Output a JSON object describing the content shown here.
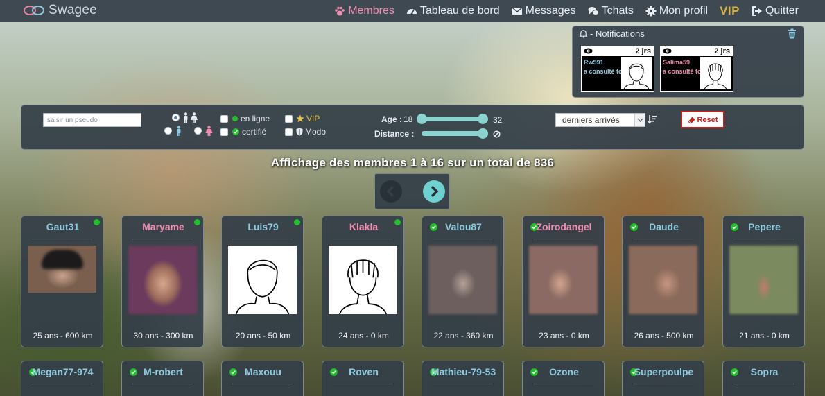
{
  "app": {
    "logo_text": "Swagee"
  },
  "nav": {
    "items": [
      {
        "label": "Membres",
        "icon": "paw-icon"
      },
      {
        "label": "Tableau de bord",
        "icon": "dashboard-icon"
      },
      {
        "label": "Messages",
        "icon": "envelope-icon"
      },
      {
        "label": "Tchats",
        "icon": "chat-bubbles-icon"
      },
      {
        "label": "Mon profil",
        "icon": "gear-icon"
      },
      {
        "label": "VIP",
        "icon": "vip-text"
      },
      {
        "label": "Quitter",
        "icon": "sign-out-icon"
      }
    ],
    "active_color": "#f08db0",
    "vip_color": "#d6b23e"
  },
  "notifications": {
    "title": "- Notifications",
    "items": [
      {
        "days": "2 jrs",
        "username": "Rw591",
        "message": "a consulté ton profil",
        "gender": "male"
      },
      {
        "days": "2 jrs",
        "username": "Salima59",
        "message": "a consulté ton profil",
        "gender": "female"
      }
    ]
  },
  "filters": {
    "pseudo_placeholder": "saisir un pseudo",
    "online_label": "en ligne",
    "certified_label": "certifié",
    "vip_label": "VIP",
    "modo_label": "Modo",
    "age_label": "Age :",
    "age_min": "18",
    "age_max": "32",
    "distance_label": "Distance :",
    "sort_selected": "derniers arrivés",
    "reset_label": "Reset"
  },
  "display_text": "Affichage des membres 1 à 16 sur un total de 836",
  "members_row1": [
    {
      "name": "Gaut31",
      "info": "25 ans - 600 km",
      "gender": "male",
      "online": true,
      "certified": false,
      "photo": "blurred"
    },
    {
      "name": "Maryame",
      "info": "30 ans - 300 km",
      "gender": "female",
      "online": true,
      "certified": false,
      "photo": "blurred"
    },
    {
      "name": "Luis79",
      "info": "20 ans - 50 km",
      "gender": "male",
      "online": true,
      "certified": false,
      "photo": "avatar-male"
    },
    {
      "name": "Klakla",
      "info": "24 ans - 0 km",
      "gender": "female",
      "online": true,
      "certified": false,
      "photo": "avatar-female"
    },
    {
      "name": "Valou87",
      "info": "22 ans - 360 km",
      "gender": "male",
      "online": false,
      "certified": true,
      "photo": "blurred"
    },
    {
      "name": "Zoirodangel",
      "info": "23 ans - 0 km",
      "gender": "female",
      "online": false,
      "certified": true,
      "photo": "blurred"
    },
    {
      "name": "Daude",
      "info": "26 ans - 500 km",
      "gender": "male",
      "online": false,
      "certified": true,
      "photo": "blurred"
    },
    {
      "name": "Pepere",
      "info": "21 ans - 0 km",
      "gender": "male",
      "online": false,
      "certified": true,
      "photo": "blurred"
    }
  ],
  "members_row2": [
    {
      "name": "Megan77-974",
      "gender": "male",
      "certified": true
    },
    {
      "name": "M-robert",
      "gender": "male",
      "certified": true
    },
    {
      "name": "Maxouu",
      "gender": "male",
      "certified": true
    },
    {
      "name": "Roven",
      "gender": "male",
      "certified": true
    },
    {
      "name": "Mathieu-79-53",
      "gender": "male",
      "certified": true
    },
    {
      "name": "Ozone",
      "gender": "male",
      "certified": true
    },
    {
      "name": "Superpoulpe",
      "gender": "male",
      "certified": true
    },
    {
      "name": "Sopra",
      "gender": "male",
      "certified": true
    }
  ]
}
